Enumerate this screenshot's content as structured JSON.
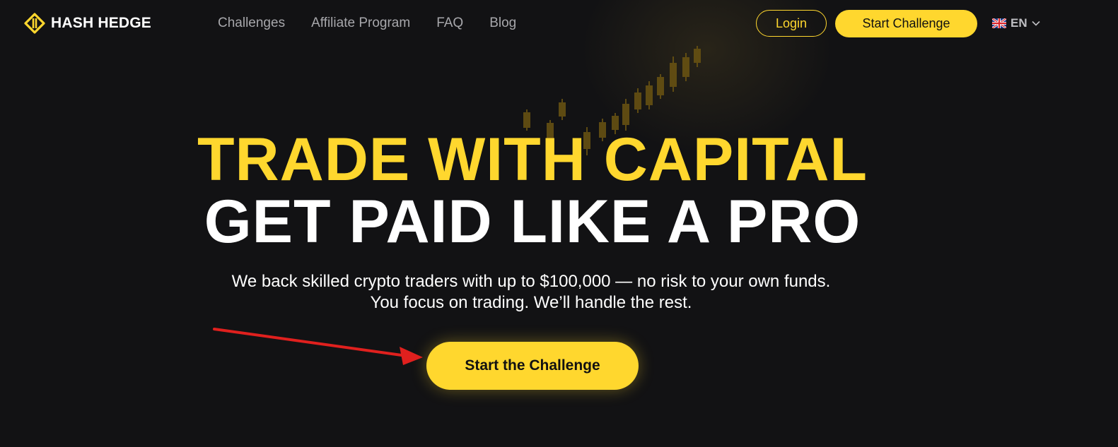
{
  "brand": {
    "name": "HASH HEDGE",
    "accent_color": "#ffd72e"
  },
  "nav": {
    "links": [
      {
        "label": "Challenges"
      },
      {
        "label": "Affiliate Program"
      },
      {
        "label": "FAQ"
      },
      {
        "label": "Blog"
      }
    ],
    "login_label": "Login",
    "start_label": "Start Challenge",
    "language": {
      "code": "EN",
      "flag_icon": "uk-flag-icon"
    }
  },
  "hero": {
    "headline_1": "TRADE WITH CAPITAL",
    "headline_2": "GET PAID LIKE A PRO",
    "subtitle_1": "We back skilled crypto traders with up to $100,000 — no risk to your own funds.",
    "subtitle_2": "You focus on trading. We’ll handle the rest.",
    "cta_label": "Start the Challenge"
  },
  "annotation": {
    "arrow_color": "#e0201e"
  }
}
